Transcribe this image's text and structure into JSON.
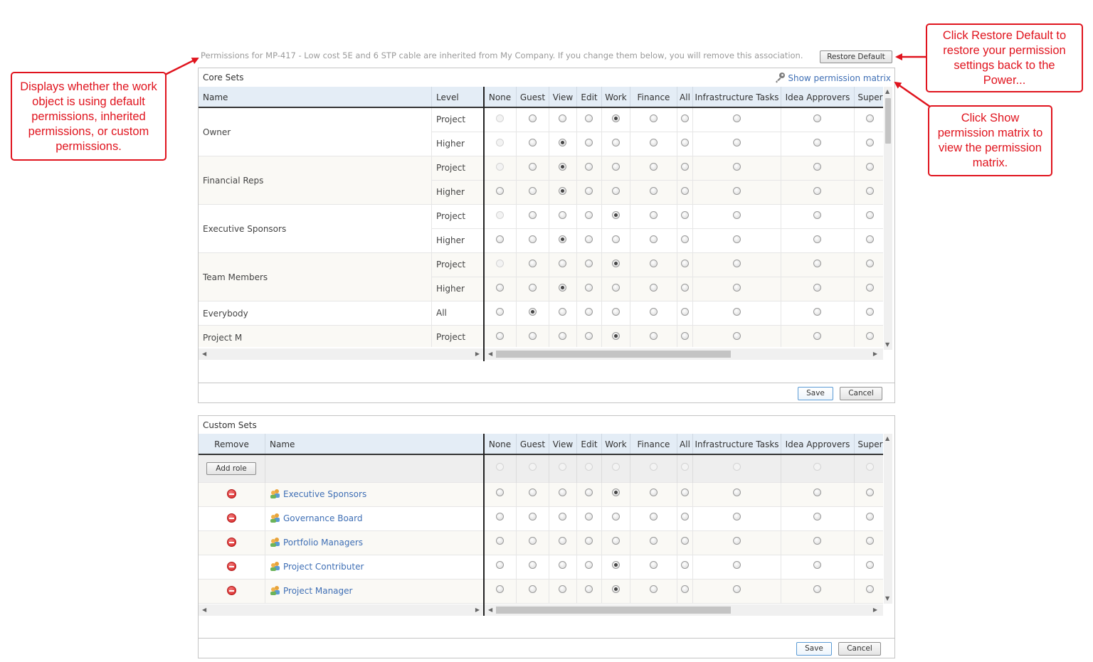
{
  "info_text": "Permissions for MP-417 - Low cost 5E and 6 STP cable are inherited from My Company. If you change them below, you will remove this association.",
  "restore_default_label": "Restore Default",
  "columns": [
    "None",
    "Guest",
    "View",
    "Edit",
    "Work",
    "Finance",
    "All",
    "Infrastructure Tasks",
    "Idea Approvers",
    "Super"
  ],
  "core": {
    "title": "Core Sets",
    "show_matrix_label": "Show permission matrix",
    "header_name": "Name",
    "header_level": "Level",
    "rows": [
      {
        "name": "Owner",
        "level": "Project",
        "selected": 4,
        "disabled_none": true
      },
      {
        "name": "",
        "level": "Higher",
        "selected": 2,
        "disabled_none": true
      },
      {
        "name": "Financial Reps",
        "level": "Project",
        "selected": 2,
        "disabled_none": true
      },
      {
        "name": "",
        "level": "Higher",
        "selected": 2,
        "disabled_none": false
      },
      {
        "name": "Executive Sponsors",
        "level": "Project",
        "selected": 4,
        "disabled_none": true
      },
      {
        "name": "",
        "level": "Higher",
        "selected": 2,
        "disabled_none": false
      },
      {
        "name": "Team Members",
        "level": "Project",
        "selected": 4,
        "disabled_none": true
      },
      {
        "name": "",
        "level": "Higher",
        "selected": 2,
        "disabled_none": false
      },
      {
        "name": "Everybody",
        "level": "All",
        "selected": 1,
        "disabled_none": false
      },
      {
        "name": "Project M",
        "level": "Project",
        "selected": 4,
        "disabled_none": false
      }
    ],
    "save_label": "Save",
    "cancel_label": "Cancel"
  },
  "custom": {
    "title": "Custom Sets",
    "header_remove": "Remove",
    "header_name": "Name",
    "add_role_label": "Add role",
    "rows": [
      {
        "name": "Executive Sponsors",
        "selected": 4
      },
      {
        "name": "Governance Board",
        "selected": -1
      },
      {
        "name": "Portfolio Managers",
        "selected": -1
      },
      {
        "name": "Project Contributer",
        "selected": 4
      },
      {
        "name": "Project Manager",
        "selected": 4
      }
    ],
    "save_label": "Save",
    "cancel_label": "Cancel"
  },
  "callouts": {
    "left": "Displays whether the work object is using default permissions, inherited permissions, or custom permissions.",
    "top_right": "Click Restore Default to restore your permission settings back to the Power...",
    "right": "Click Show permission matrix to view the permission matrix."
  },
  "colors": {
    "callout": "#e0141e",
    "header_bg": "#e4edf6",
    "link": "#3f6fb5"
  },
  "icons": {
    "matrix": "key-icon",
    "remove": "remove-icon",
    "role": "people-icon"
  }
}
